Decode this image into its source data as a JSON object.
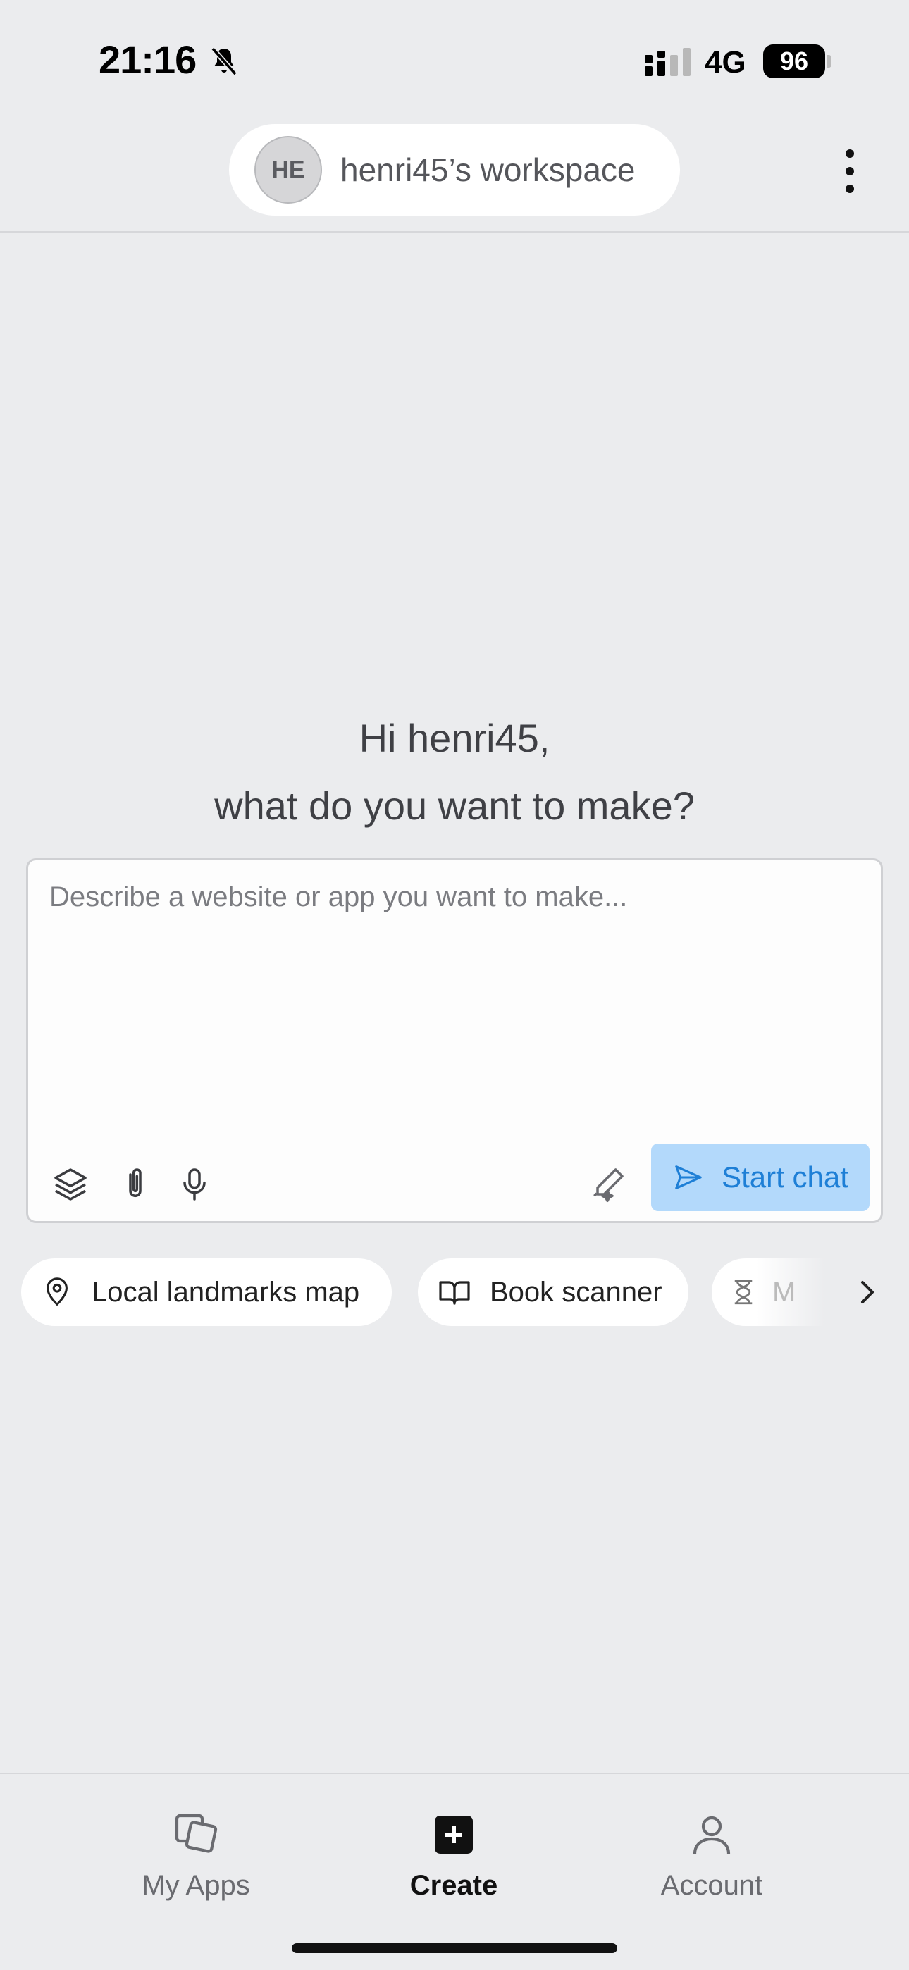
{
  "status_bar": {
    "time": "21:16",
    "network": "4G",
    "battery": "96",
    "silent_icon": "bell-slash-icon",
    "signal_icon": "signal-bars-icon"
  },
  "header": {
    "avatar_initials": "HE",
    "workspace_name": "henri45’s workspace",
    "menu_icon": "more-vertical-icon"
  },
  "greeting": {
    "line1": "Hi henri45,",
    "line2": "what do you want to make?"
  },
  "prompt": {
    "placeholder": "Describe a website or app you want to make...",
    "value": "",
    "tools": [
      "layers-icon",
      "paperclip-icon",
      "microphone-icon",
      "magic-pen-icon"
    ],
    "start_chat_label": "Start chat",
    "accent_color": "#1e7fd6",
    "button_bg": "#b3d9fb"
  },
  "suggestions": [
    {
      "label": "Local landmarks map",
      "icon": "map-pin-icon"
    },
    {
      "label": "Book scanner",
      "icon": "book-open-icon"
    },
    {
      "label": "M",
      "icon": "hourglass-icon"
    }
  ],
  "bottom_nav": [
    {
      "label": "My Apps",
      "icon": "apps-stack-icon",
      "active": false
    },
    {
      "label": "Create",
      "icon": "plus-square-icon",
      "active": true
    },
    {
      "label": "Account",
      "icon": "user-icon",
      "active": false
    }
  ]
}
